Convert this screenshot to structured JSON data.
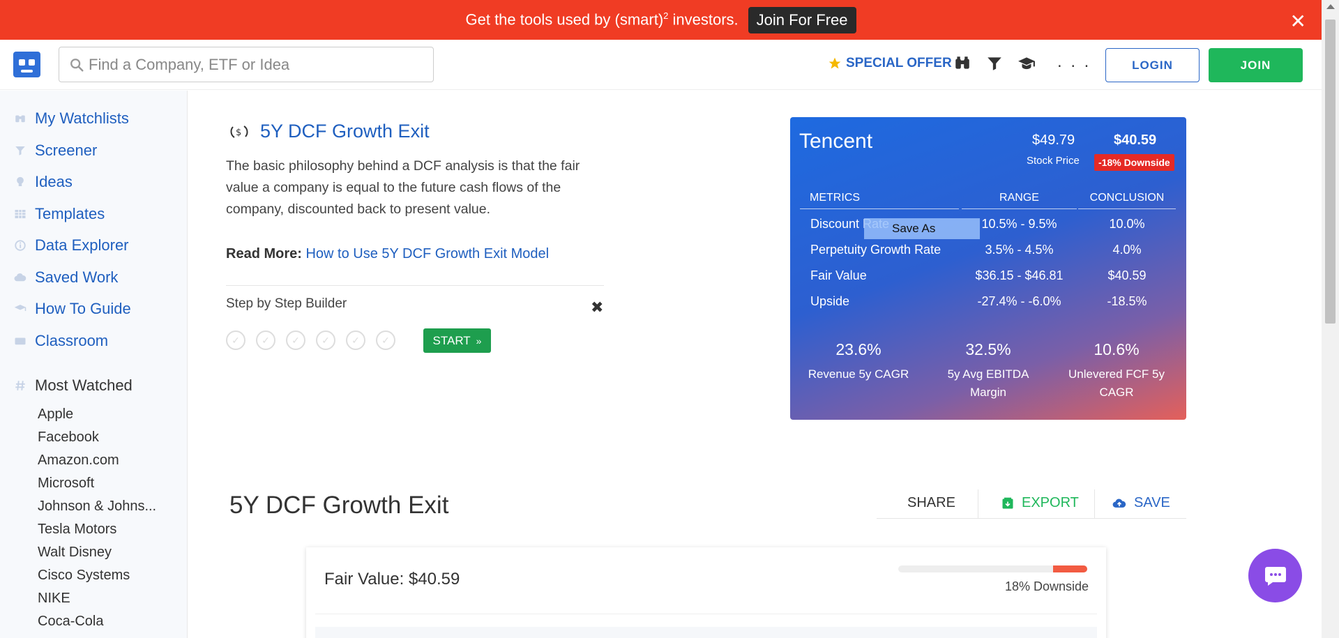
{
  "promo": {
    "text_before": "Get the tools used by (smart)",
    "superscript": "2",
    "text_after": " investors.",
    "cta": "Join For Free"
  },
  "header": {
    "search_placeholder": "Find a Company, ETF or Idea",
    "special_offer": "SPECIAL OFFER",
    "more": ". . .",
    "login": "LOGIN",
    "join": "JOIN"
  },
  "sidebar": {
    "items": [
      {
        "label": "My Watchlists"
      },
      {
        "label": "Screener"
      },
      {
        "label": "Ideas"
      },
      {
        "label": "Templates"
      },
      {
        "label": "Data Explorer"
      },
      {
        "label": "Saved Work"
      },
      {
        "label": "How To Guide"
      },
      {
        "label": "Classroom"
      }
    ],
    "most_watched_title": "Most Watched",
    "most_watched": [
      "Apple",
      "Facebook",
      "Amazon.com",
      "Microsoft",
      "Johnson & Johns...",
      "Tesla Motors",
      "Walt Disney",
      "Cisco Systems",
      "NIKE",
      "Coca-Cola"
    ]
  },
  "model": {
    "title": "5Y DCF Growth Exit",
    "description": "The basic philosophy behind a DCF analysis is that the fair value a company is equal to the future cash flows of the company, discounted back to present value.",
    "read_more_label": "Read More:",
    "read_more_link": "How to Use 5Y DCF Growth Exit Model",
    "step_builder": "Step by Step Builder",
    "start": "START",
    "steps_total": 6
  },
  "card": {
    "company": "Tencent",
    "stock_price": "$49.79",
    "stock_price_label": "Stock Price",
    "fair_value": "$40.59",
    "badge": "-18% Downside",
    "headers": {
      "metrics": "METRICS",
      "range": "RANGE",
      "conclusion": "CONCLUSION"
    },
    "rows": [
      {
        "metric": "Discount Rate",
        "range": "10.5% - 9.5%",
        "conclusion": "10.0%"
      },
      {
        "metric": "Perpetuity Growth Rate",
        "range": "3.5% - 4.5%",
        "conclusion": "4.0%"
      },
      {
        "metric": "Fair Value",
        "range": "$36.15 - $46.81",
        "conclusion": "$40.59"
      },
      {
        "metric": "Upside",
        "range": "-27.4% - -6.0%",
        "conclusion": "-18.5%"
      }
    ],
    "tooltip": "Save As",
    "stats": [
      {
        "value": "23.6%",
        "label": "Revenue 5y CAGR"
      },
      {
        "value": "32.5%",
        "label": "5y Avg EBITDA Margin"
      },
      {
        "value": "10.6%",
        "label": "Unlevered FCF 5y CAGR"
      }
    ]
  },
  "section": {
    "title": "5Y DCF Growth Exit",
    "share": "SHARE",
    "export": "EXPORT",
    "save": "SAVE",
    "fair_value": "Fair Value: $40.59",
    "downside": "18% Downside",
    "downside_fraction": 0.18
  },
  "colors": {
    "promo": "#f03c24",
    "link_blue": "#1f5fbf",
    "join_green": "#1fb75b",
    "badge_red": "#e52a25",
    "chat_purple": "#8a4ce6"
  }
}
